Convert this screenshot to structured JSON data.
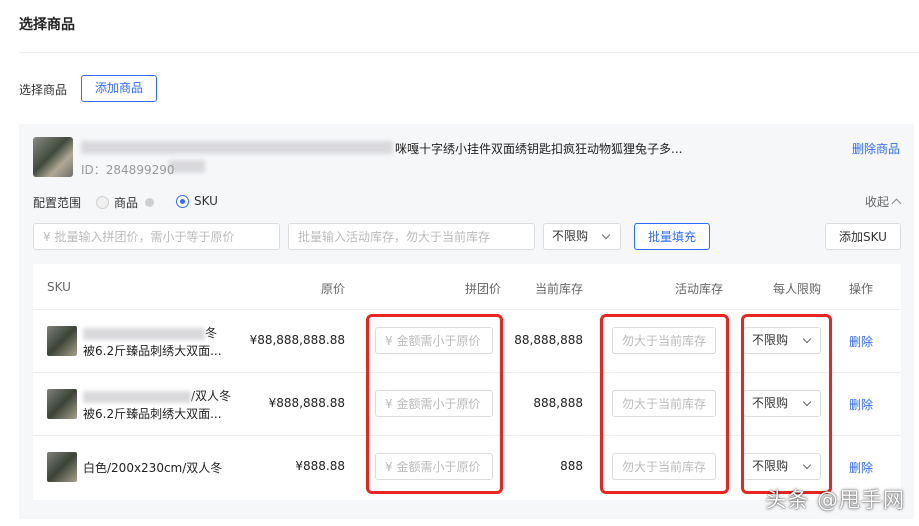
{
  "header": {
    "title": "选择商品"
  },
  "pick": {
    "label": "选择商品",
    "add_button": "添加商品"
  },
  "product": {
    "title": "咪嘎十字绣小挂件双面绣钥匙扣疯狂动物狐狸兔子多...",
    "id": "ID：284899290",
    "delete_label": "删除商品"
  },
  "config": {
    "label": "配置范围",
    "options": [
      "商品",
      "SKU"
    ],
    "selected": "SKU",
    "collapse_label": "收起"
  },
  "batch": {
    "price_placeholder": "¥ 批量输入拼团价，需小于等于原价",
    "stock_placeholder": "批量输入活动库存，勿大于当前库存",
    "limit_value": "不限购",
    "fill_button": "批量填充",
    "add_sku_button": "添加SKU"
  },
  "table": {
    "columns": [
      "SKU",
      "原价",
      "拼团价",
      "当前库存",
      "活动库存",
      "每人限购",
      "操作"
    ],
    "price_placeholder": "¥ 金额需小于原价",
    "stock_placeholder": "勿大于当前库存",
    "rows": [
      {
        "name_line1": "冬",
        "name_line2": "被6.2斤臻品刺绣大双面...",
        "price": "¥88,888,888.88",
        "stock": "88,888,888",
        "limit": "不限购",
        "action": "删除"
      },
      {
        "name_line1": "/双人冬",
        "name_line2": "被6.2斤臻品刺绣大双面...",
        "price": "¥888,888.88",
        "stock": "888,888",
        "limit": "不限购",
        "action": "删除"
      },
      {
        "name_line1": "白色/200x230cm/双人冬",
        "name_line2": "",
        "price": "¥888.88",
        "stock": "888",
        "limit": "不限购",
        "action": "删除"
      }
    ]
  },
  "colors": {
    "accent": "#2f6bff",
    "highlight": "#e8261f"
  },
  "watermark": "头条 @甩手网"
}
